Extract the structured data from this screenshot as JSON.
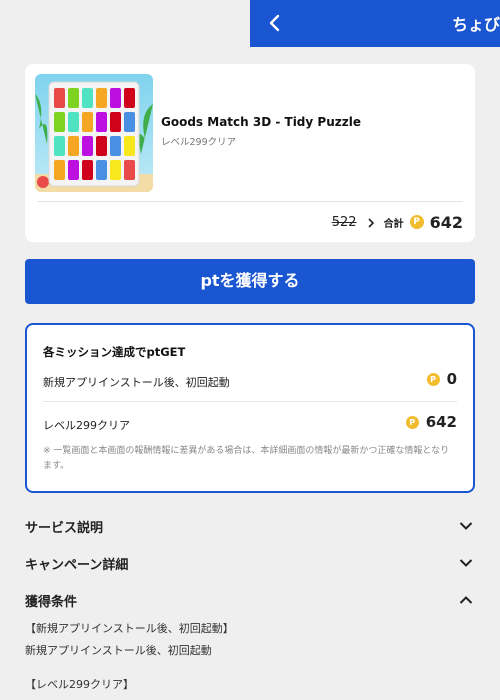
{
  "header": {
    "title": "ちょびリッチ"
  },
  "offer": {
    "app_name": "Goods Match 3D - Tidy Puzzle",
    "subtitle": "レベル299クリア",
    "old_price": "522",
    "total_label": "合計",
    "coin_symbol": "P",
    "total_price": "642"
  },
  "cta": {
    "label": "ptを獲得する"
  },
  "mission": {
    "title": "各ミッション達成でptGET",
    "rows": [
      {
        "label": "新規アプリインストール後、初回起動",
        "value": "0"
      },
      {
        "label": "レベル299クリア",
        "value": "642"
      }
    ],
    "note": "※ 一覧画面と本画面の報酬情報に差異がある場合は、本詳細画面の情報が最新かつ正確な情報となります。"
  },
  "sections": [
    {
      "label": "サービス説明",
      "expanded": false
    },
    {
      "label": "キャンペーン詳細",
      "expanded": false
    },
    {
      "label": "獲得条件",
      "expanded": true
    }
  ],
  "conditions": [
    "【新規アプリインストール後、初回起動】",
    "新規アプリインストール後、初回起動",
    "【レベル299クリア】"
  ],
  "colors": {
    "primary": "#1a55d2",
    "coin": "#f1bd2f",
    "background": "#efefef"
  }
}
